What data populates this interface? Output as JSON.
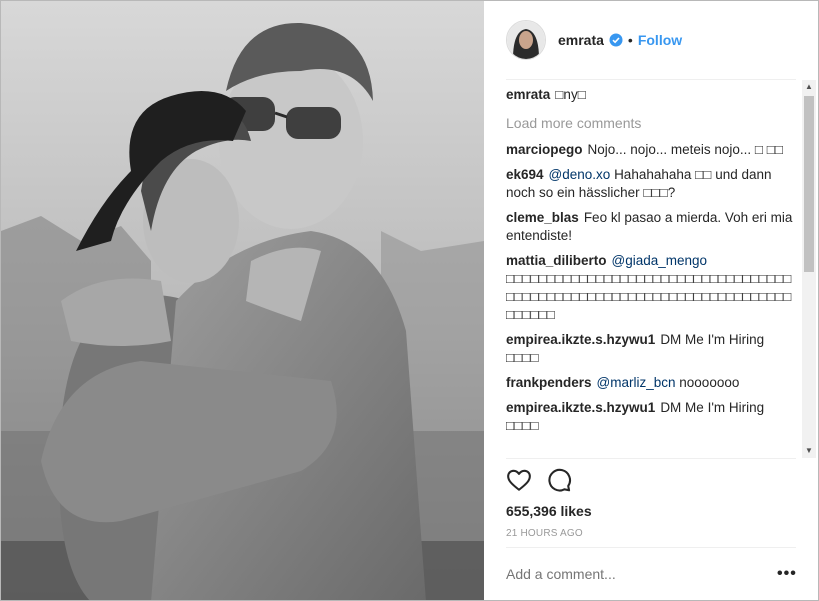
{
  "header": {
    "username": "emrata",
    "verified": true,
    "separator": "•",
    "follow_label": "Follow"
  },
  "caption": {
    "username": "emrata",
    "text": "□ny□"
  },
  "load_more_label": "Load more comments",
  "comments": [
    {
      "username": "marciopego",
      "mention": "",
      "text": "Nojo... nojo... meteis nojo... □ □□"
    },
    {
      "username": "ek694",
      "mention": "@deno.xo",
      "text": "Hahahahaha □□ und dann noch so ein hässlicher □□□?"
    },
    {
      "username": "cleme_blas",
      "mention": "",
      "text": "Feo kl pasao a mierda. Voh eri mia entendiste!"
    },
    {
      "username": "mattia_diliberto",
      "mention": "@giada_mengo",
      "text": "□□□□□□□□□□□□□□□□□□□□□□□□□□□□□□□□□□□□□□□□□□□□□□□□□□□□□□□□□□□□□□□□□□□□□□□□□□□□"
    },
    {
      "username": "empirea.ikzte.s.hzywu1",
      "mention": "",
      "text": "DM Me I'm Hiring □□□□"
    },
    {
      "username": "frankpenders",
      "mention": "@marliz_bcn",
      "text": "nooooooo"
    },
    {
      "username": "empirea.ikzte.s.hzywu1",
      "mention": "",
      "text": "DM Me I'm Hiring □□□□"
    }
  ],
  "icons": [
    "heart-icon",
    "comment-icon",
    "verified-badge-icon",
    "more-options-icon"
  ],
  "likes": "655,396 likes",
  "timestamp": "21 HOURS AGO",
  "add_comment_placeholder": "Add a comment...",
  "more_label": "•••",
  "scroll": {
    "up": "▲",
    "down": "▼"
  },
  "colors": {
    "link": "#3897f0",
    "mention": "#003569",
    "muted": "#999999",
    "text": "#262626"
  }
}
